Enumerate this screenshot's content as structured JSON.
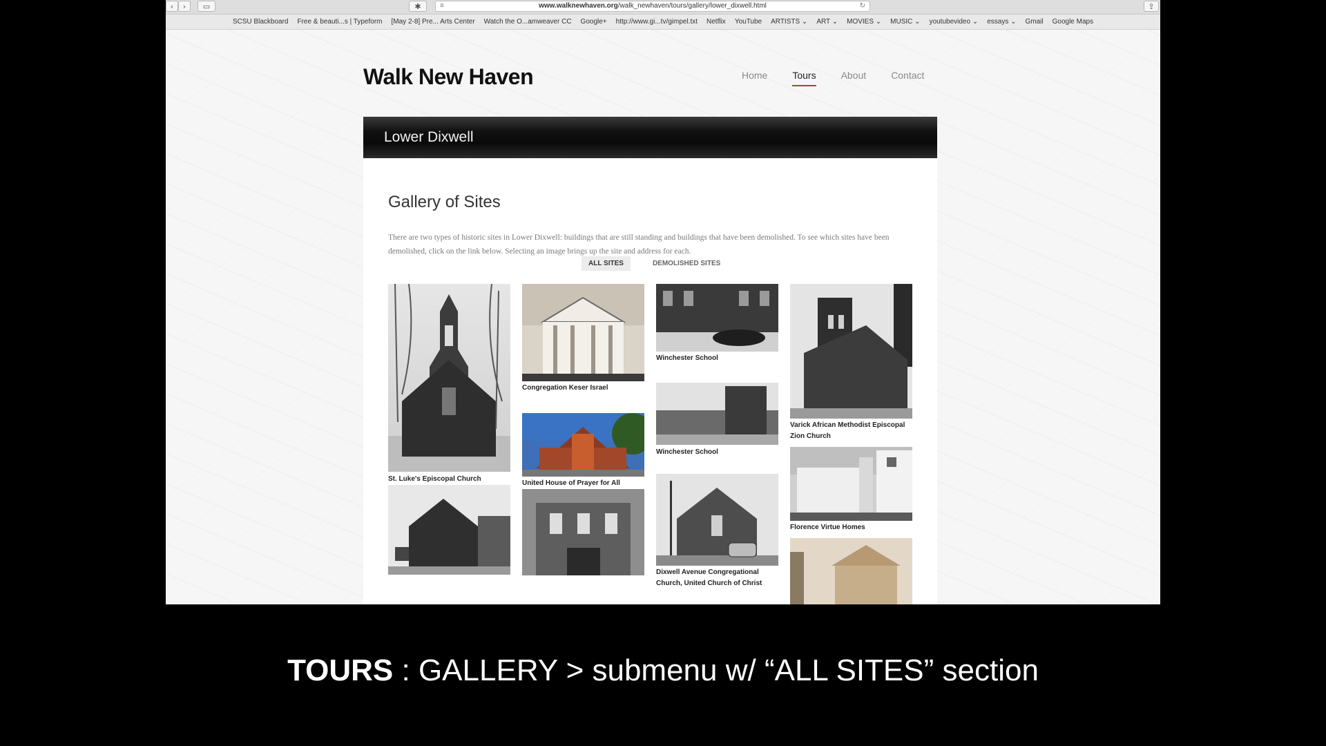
{
  "browser": {
    "url_domain": "www.walknewhaven.org",
    "url_path": "/walk_newhaven/tours/gallery/lower_dixwell.html",
    "bookmarks": [
      "SCSU Blackboard",
      "Free & beauti...s | Typeform",
      "[May 2-8] Pre... Arts Center",
      "Watch the O...amweaver CC",
      "Google+",
      "http://www.gi...tv/gimpel.txt",
      "Netflix",
      "YouTube",
      "ARTISTS ⌄",
      "ART ⌄",
      "MOVIES ⌄",
      "MUSIC ⌄",
      "youtubevideo ⌄",
      "essays ⌄",
      "Gmail",
      "Google Maps"
    ]
  },
  "site": {
    "title": "Walk New Haven",
    "nav": [
      {
        "label": "Home",
        "active": false
      },
      {
        "label": "Tours",
        "active": true
      },
      {
        "label": "About",
        "active": false
      },
      {
        "label": "Contact",
        "active": false
      }
    ],
    "banner": "Lower Dixwell"
  },
  "gallery": {
    "heading": "Gallery of Sites",
    "intro": "There are two types of historic sites in Lower Dixwell: buildings that are still standing and buildings that have been demolished. To see which sites have been demolished, click on the link below. Selecting an image brings up the site and address for each.",
    "filters": [
      "ALL SITES",
      "DEMOLISHED SITES"
    ],
    "items": [
      {
        "caption": "St. Luke's Episcopal Church"
      },
      {
        "caption": "Congregation Keser Israel"
      },
      {
        "caption": "United House of Prayer for All People"
      },
      {
        "caption": "Winchester School"
      },
      {
        "caption": "Winchester School"
      },
      {
        "caption": "Dixwell Avenue Congregational Church, United Church of Christ"
      },
      {
        "caption": "Varick African Methodist Episcopal Zion Church"
      },
      {
        "caption": "Florence Virtue Homes"
      },
      {
        "caption": ""
      },
      {
        "caption": ""
      },
      {
        "caption": ""
      }
    ]
  },
  "slide_caption": {
    "bold": "TOURS",
    "rest": " : GALLERY > submenu w/ “ALL SITES” section"
  }
}
